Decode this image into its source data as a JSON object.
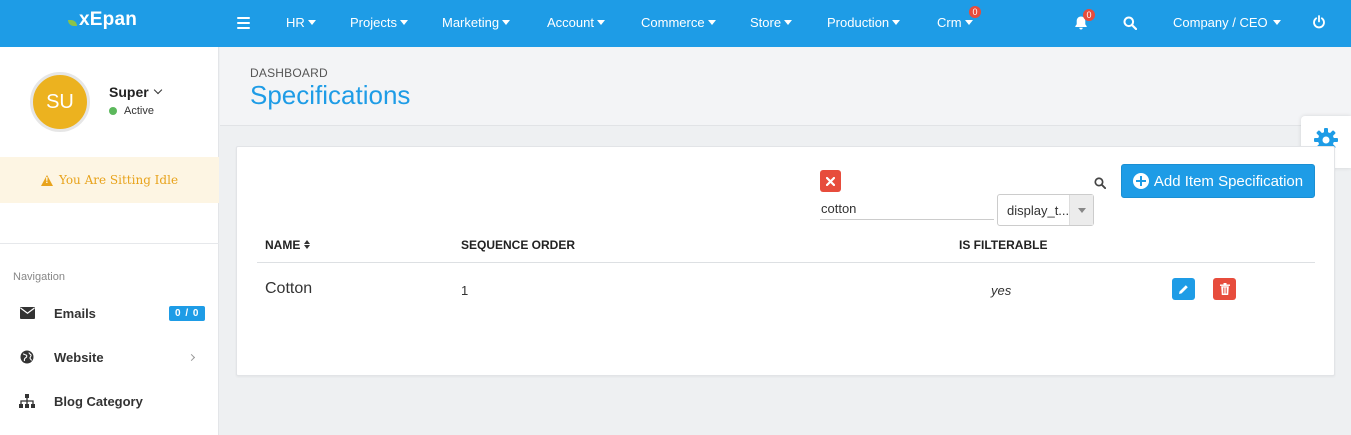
{
  "brand": {
    "name": "xEpan"
  },
  "topnav": {
    "items": [
      {
        "label": "HR"
      },
      {
        "label": "Projects"
      },
      {
        "label": "Marketing"
      },
      {
        "label": "Account"
      },
      {
        "label": "Commerce"
      },
      {
        "label": "Store"
      },
      {
        "label": "Production"
      },
      {
        "label": "Crm",
        "badge": "0"
      }
    ],
    "notification_badge": "0",
    "company_label": "Company / CEO"
  },
  "sidebar": {
    "avatar_initials": "SU",
    "user_name": "Super",
    "user_status": "Active",
    "idle_message": "You Are Sitting Idle",
    "nav_heading": "Navigation",
    "items": [
      {
        "label": "Emails",
        "icon": "envelope-icon",
        "badge": "0 / 0"
      },
      {
        "label": "Website",
        "icon": "globe-icon"
      },
      {
        "label": "Blog Category",
        "icon": "sitemap-icon"
      }
    ]
  },
  "header": {
    "breadcrumb": "DASHBOARD",
    "title": "Specifications"
  },
  "toolbar": {
    "search_value": "cotton",
    "select_value": "display_t...",
    "add_label": "Add Item Specification"
  },
  "table": {
    "columns": [
      "NAME",
      "SEQUENCE ORDER",
      "IS FILTERABLE"
    ],
    "rows": [
      {
        "name": "Cotton",
        "sequence_order": "1",
        "is_filterable": "yes"
      }
    ]
  },
  "colors": {
    "primary": "#1e9ce6",
    "danger": "#e74c3c",
    "warning": "#e8a31c",
    "avatar": "#ecb21f",
    "success": "#5cb85c"
  }
}
